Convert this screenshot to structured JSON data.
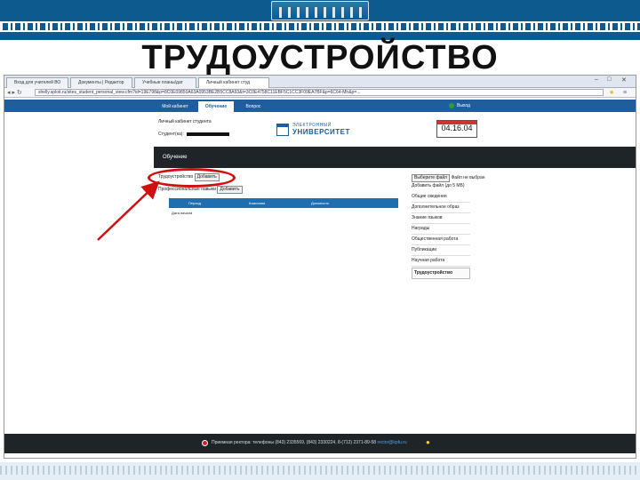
{
  "slide": {
    "title": "ТРУДОУСТРОЙСТВО"
  },
  "browser": {
    "tabs": [
      {
        "label": "Вход для учителей ВО",
        "active": false
      },
      {
        "label": "Документы | Редактор",
        "active": false
      },
      {
        "label": "Учебные планы/дат",
        "active": false
      },
      {
        "label": "Личный кабинет студ",
        "active": true
      }
    ],
    "url": "shelly.sploit.ru/sites_student_personal_view.cfm?id=19E798&p=8C0E09850A63A0953BE2B5CC8A93&t=3C0E4758C11EBF5C1CC3F09EA7BF&p=6C64-Mh&p=..."
  },
  "site": {
    "nav": {
      "tabs": [
        {
          "label": "Мой кабинет",
          "active": false
        },
        {
          "label": "Обучение",
          "active": true
        },
        {
          "label": "Вопрос",
          "active": false
        }
      ],
      "exit_label": "Выход"
    },
    "header": {
      "cabinet_title": "Личный кабинет студента",
      "student_label": "Студент(ка):"
    },
    "logo": {
      "line1": "ЭЛЕКТРОННЫЙ",
      "line2": "УНИВЕРСИТЕТ"
    },
    "date": "04.16.04",
    "section_title": "Обучение",
    "forms": {
      "row1_label": "Трудоустройство",
      "row1_button": "Добавить",
      "row2_label": "Профессиональные навыки",
      "row2_button": "Добавить"
    },
    "table": {
      "columns": [
        "Период",
        "Компания",
        "Должность"
      ],
      "first_row": "Дата начала"
    },
    "sidebar": {
      "select_label": "Выберите файл",
      "select_value": "Файл не выбран",
      "add_label": "Добавить файл (до 5 МБ)",
      "items": [
        {
          "label": "Общие сведения",
          "selected": false
        },
        {
          "label": "Дополнительное образ",
          "selected": false
        },
        {
          "label": "Знание языков",
          "selected": false
        },
        {
          "label": "Награды",
          "selected": false
        },
        {
          "label": "Общественная работа",
          "selected": false
        },
        {
          "label": "Публикации",
          "selected": false
        },
        {
          "label": "Научная работа",
          "selected": false
        },
        {
          "label": "Трудоустройство",
          "selected": true
        }
      ]
    },
    "footer": {
      "text": "Приемная ректора: телефоны (843) 2335569, (843) 2330224, 8-(712) 2371-89-58",
      "link": "rector@kpfu.ru"
    }
  },
  "colors": {
    "banner": "#0d5a8e",
    "nav": "#1f5d9c",
    "dark": "#1e2428",
    "highlight": "#d01010"
  }
}
